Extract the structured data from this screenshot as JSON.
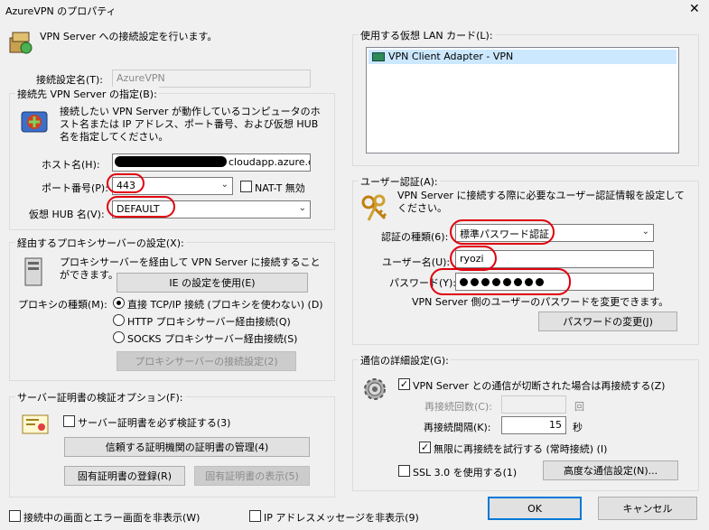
{
  "window": {
    "title": "AzureVPN のプロパティ",
    "close_glyph": "✕"
  },
  "header": {
    "text": "VPN Server への接続設定を行います。"
  },
  "connection_name": {
    "label": "接続設定名(T):",
    "value": "AzureVPN"
  },
  "server_group": {
    "title": "接続先 VPN Server の指定(B):",
    "description": "接続したい VPN Server が動作しているコンピュータのホスト名または IP アドレス、ポート番号、および仮想 HUB 名を指定してください。",
    "host_label": "ホスト名(H):",
    "host_value": "cloudapp.azure.cor",
    "port_label": "ポート番号(P):",
    "port_value": "443",
    "natt_label": "NAT-T 無効",
    "hub_label": "仮想 HUB 名(V):",
    "hub_value": "DEFAULT"
  },
  "proxy_group": {
    "title": "経由するプロキシサーバーの設定(X):",
    "description": "プロキシサーバーを経由して VPN Server に接続することができます。",
    "ie_button": "IE の設定を使用(E)",
    "type_label": "プロキシの種類(M):",
    "options": [
      "直接 TCP/IP 接続 (プロキシを使わない) (D)",
      "HTTP プロキシサーバー経由接続(Q)",
      "SOCKS プロキシサーバー経由接続(S)"
    ],
    "settings_button": "プロキシサーバーの接続設定(2)"
  },
  "cert_group": {
    "title": "サーバー証明書の検証オプション(F):",
    "verify_label": "サーバー証明書を必ず検証する(3)",
    "manage_button": "信頼する証明機関の証明書の管理(4)",
    "register_button": "固有証明書の登録(R)",
    "show_button": "固有証明書の表示(5)"
  },
  "lan_group": {
    "title": "使用する仮想 LAN カード(L):",
    "items": [
      "VPN Client Adapter - VPN"
    ]
  },
  "auth_group": {
    "title": "ユーザー認証(A):",
    "description": "VPN Server に接続する際に必要なユーザー認証情報を設定してください。",
    "type_label": "認証の種類(6):",
    "type_value": "標準パスワード認証",
    "user_label": "ユーザー名(U):",
    "user_value": "ryozi",
    "password_label": "パスワード(Y):",
    "password_length": 8,
    "note": "VPN Server 側のユーザーのパスワードを変更できます。",
    "change_button": "パスワードの変更(J)"
  },
  "comm_group": {
    "title": "通信の詳細設定(G):",
    "reconnect_label": "VPN Server との通信が切断された場合は再接続する(Z)",
    "retry_count_label": "再接続回数(C):",
    "retry_count_suffix": "回",
    "interval_label": "再接続間隔(K):",
    "interval_value": "15",
    "interval_suffix": "秒",
    "infinite_label": "無限に再接続を試行する (常時接続) (I)",
    "ssl_label": "SSL 3.0 を使用する(1)",
    "advanced_button": "高度な通信設定(N)..."
  },
  "footer": {
    "hide_status_label": "接続中の画面とエラー画面を非表示(W)",
    "hide_ip_label": "IP アドレスメッセージを非表示(9)",
    "ok_button": "OK",
    "cancel_button": "キャンセル"
  },
  "annotation_color": "#e0000e"
}
